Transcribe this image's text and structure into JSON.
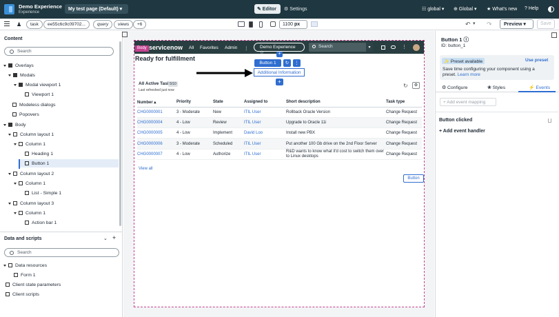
{
  "header": {
    "app_name": "Demo Experience",
    "app_sub": "Experience",
    "page_selector": "My test page (Default) ▾",
    "editor_label": "✎ Editor",
    "settings_label": "⚙ Settings",
    "scope": "☷ global ▾",
    "language": "⊕ Global ▾",
    "whats_new": "★ What's new",
    "help": "? Help"
  },
  "toolbar": {
    "chips": [
      "task",
      "ee55c6c9c09702...",
      "query",
      "views",
      "+6"
    ],
    "width_value": "1100",
    "width_unit": "px",
    "preview_label": "Preview ▾",
    "save_label": "Save"
  },
  "left_panel": {
    "content_title": "Content",
    "search_placeholder": "Search",
    "tree": [
      "Overlays",
      "Modals",
      "Modal viewport 1",
      "Viewport 1",
      "Modeless dialogs",
      "Popovers",
      "Body",
      "Column layout 1",
      "Column 1",
      "Heading 1",
      "Button 1",
      "Column layout 2",
      "Column 1",
      "List - Simple 1",
      "Column layout 3",
      "Column 1",
      "Action bar 1"
    ],
    "data_title": "Data and scripts",
    "data_search_placeholder": "Search",
    "data_tree": [
      "Data resources",
      "Form 1",
      "Client state parameters",
      "Client scripts"
    ]
  },
  "canvas": {
    "body_tag": "Body",
    "sn_logo": "servicenow",
    "nav": [
      "All",
      "Favorites",
      "Admin",
      "⋮"
    ],
    "demo_pill": "Demo Experience ☆",
    "search_placeholder": "Search",
    "page_heading": "Ready for fulfillment",
    "button1_label": "Button 1",
    "additional_info": "Additional Information",
    "list_title": "All Active Tasks",
    "list_count": "5/10",
    "refreshed": "Last refreshed just now",
    "columns": [
      "Number ▴",
      "Priority",
      "State",
      "Assigned to",
      "Short description",
      "Task type"
    ],
    "rows": [
      [
        "CHG0000001",
        "3 - Moderate",
        "New",
        "ITIL User",
        "Rollback Oracle Version",
        "Change Request"
      ],
      [
        "CHG0000004",
        "4 - Low",
        "Review",
        "ITIL User",
        "Upgrade to Oracle 11i",
        "Change Request"
      ],
      [
        "CHG0000005",
        "4 - Low",
        "Implement",
        "David Loo",
        "Install new PBX",
        "Change Request"
      ],
      [
        "CHG0000006",
        "3 - Moderate",
        "Scheduled",
        "ITIL User",
        "Put another 100 Gb drive on the 2nd Floor Server",
        "Change Request"
      ],
      [
        "CHG0000007",
        "4 - Low",
        "Authorize",
        "ITIL User",
        "R&D wants to know what it'd cost to switch them over to Linux desktops",
        "Change Request"
      ]
    ],
    "view_all": "View all",
    "page_button": "Button"
  },
  "right_panel": {
    "component_title": "Button 1 ⓘ",
    "component_id": "ID: button_1",
    "preset_chip": "✨ Preset available",
    "use_preset": "Use preset",
    "preset_text": "Save time configuring your component using a preset.",
    "learn_more": "Learn more",
    "tabs": [
      "⚙ Configure",
      "❀ Styles",
      "⚡ Events"
    ],
    "add_event_mapping": "+ Add event mapping",
    "event_name": "Button clicked",
    "add_handler": "+ Add event handler"
  },
  "colors": {
    "header_bg": "#1f3740",
    "accent": "#2f6dd0",
    "body_tag": "#c4408f"
  }
}
